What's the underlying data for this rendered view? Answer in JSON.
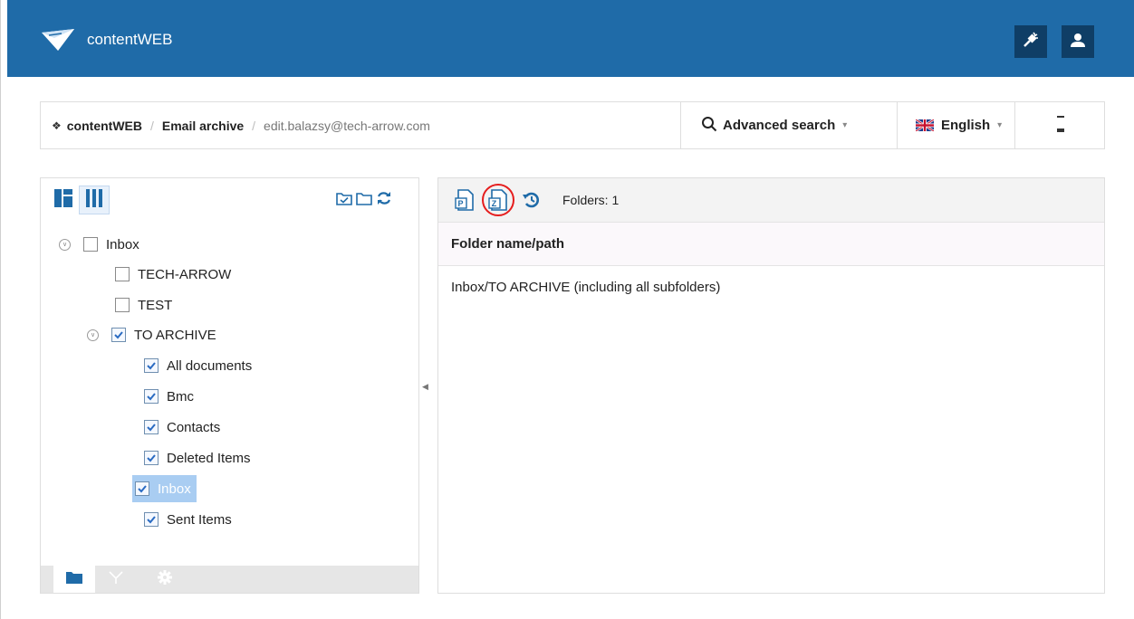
{
  "header": {
    "app_name": "contentWEB",
    "plugin_icon": "plug-icon",
    "user_icon": "user-icon",
    "bg_color": "#1f6ba8"
  },
  "breadcrumb": {
    "home": "contentWEB",
    "section": "Email archive",
    "current": "edit.balazsy@tech-arrow.com"
  },
  "search": {
    "label": "Advanced search"
  },
  "language": {
    "label": "English"
  },
  "tree": {
    "items": [
      {
        "label": "Inbox",
        "checked": false
      },
      {
        "label": "TECH-ARROW",
        "checked": false
      },
      {
        "label": "TEST",
        "checked": false
      },
      {
        "label": "TO ARCHIVE",
        "checked": true
      },
      {
        "label": "All documents",
        "checked": true
      },
      {
        "label": "Bmc",
        "checked": true
      },
      {
        "label": "Contacts",
        "checked": true
      },
      {
        "label": "Deleted Items",
        "checked": true
      },
      {
        "label": "Inbox",
        "checked": true,
        "selected": true
      },
      {
        "label": "Sent Items",
        "checked": true
      }
    ]
  },
  "right": {
    "folders_count_label": "Folders: 1",
    "column_header": "Folder name/path",
    "rows": [
      "Inbox/TO ARCHIVE (including all subfolders)"
    ]
  }
}
